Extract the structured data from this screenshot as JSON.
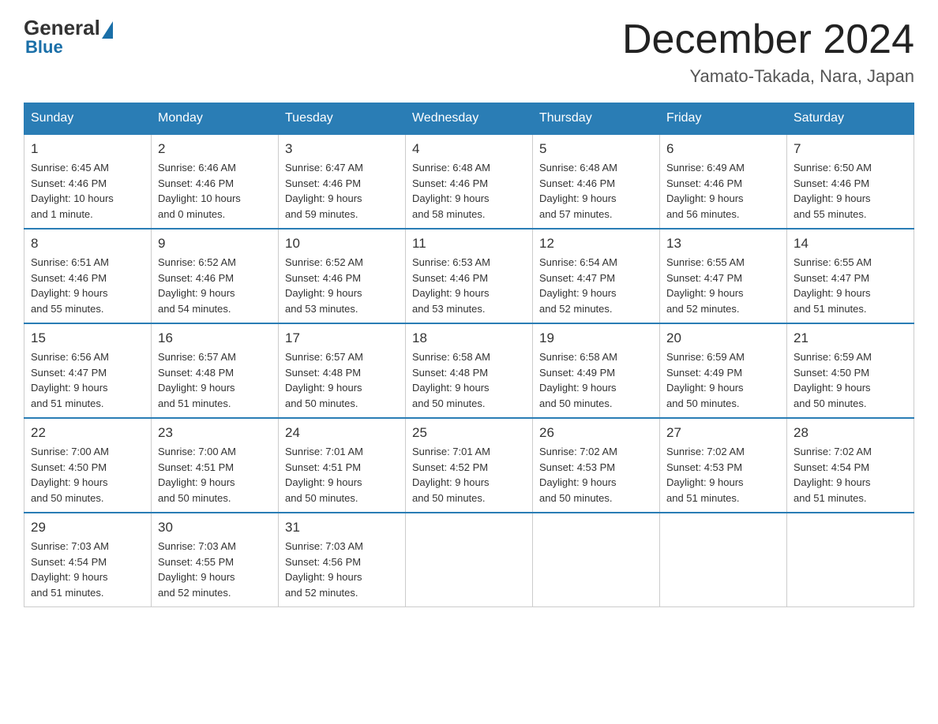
{
  "logo": {
    "general": "General",
    "blue": "Blue"
  },
  "header": {
    "month_title": "December 2024",
    "location": "Yamato-Takada, Nara, Japan"
  },
  "weekdays": [
    "Sunday",
    "Monday",
    "Tuesday",
    "Wednesday",
    "Thursday",
    "Friday",
    "Saturday"
  ],
  "weeks": [
    [
      {
        "day": "1",
        "sunrise": "6:45 AM",
        "sunset": "4:46 PM",
        "daylight": "10 hours and 1 minute."
      },
      {
        "day": "2",
        "sunrise": "6:46 AM",
        "sunset": "4:46 PM",
        "daylight": "10 hours and 0 minutes."
      },
      {
        "day": "3",
        "sunrise": "6:47 AM",
        "sunset": "4:46 PM",
        "daylight": "9 hours and 59 minutes."
      },
      {
        "day": "4",
        "sunrise": "6:48 AM",
        "sunset": "4:46 PM",
        "daylight": "9 hours and 58 minutes."
      },
      {
        "day": "5",
        "sunrise": "6:48 AM",
        "sunset": "4:46 PM",
        "daylight": "9 hours and 57 minutes."
      },
      {
        "day": "6",
        "sunrise": "6:49 AM",
        "sunset": "4:46 PM",
        "daylight": "9 hours and 56 minutes."
      },
      {
        "day": "7",
        "sunrise": "6:50 AM",
        "sunset": "4:46 PM",
        "daylight": "9 hours and 55 minutes."
      }
    ],
    [
      {
        "day": "8",
        "sunrise": "6:51 AM",
        "sunset": "4:46 PM",
        "daylight": "9 hours and 55 minutes."
      },
      {
        "day": "9",
        "sunrise": "6:52 AM",
        "sunset": "4:46 PM",
        "daylight": "9 hours and 54 minutes."
      },
      {
        "day": "10",
        "sunrise": "6:52 AM",
        "sunset": "4:46 PM",
        "daylight": "9 hours and 53 minutes."
      },
      {
        "day": "11",
        "sunrise": "6:53 AM",
        "sunset": "4:46 PM",
        "daylight": "9 hours and 53 minutes."
      },
      {
        "day": "12",
        "sunrise": "6:54 AM",
        "sunset": "4:47 PM",
        "daylight": "9 hours and 52 minutes."
      },
      {
        "day": "13",
        "sunrise": "6:55 AM",
        "sunset": "4:47 PM",
        "daylight": "9 hours and 52 minutes."
      },
      {
        "day": "14",
        "sunrise": "6:55 AM",
        "sunset": "4:47 PM",
        "daylight": "9 hours and 51 minutes."
      }
    ],
    [
      {
        "day": "15",
        "sunrise": "6:56 AM",
        "sunset": "4:47 PM",
        "daylight": "9 hours and 51 minutes."
      },
      {
        "day": "16",
        "sunrise": "6:57 AM",
        "sunset": "4:48 PM",
        "daylight": "9 hours and 51 minutes."
      },
      {
        "day": "17",
        "sunrise": "6:57 AM",
        "sunset": "4:48 PM",
        "daylight": "9 hours and 50 minutes."
      },
      {
        "day": "18",
        "sunrise": "6:58 AM",
        "sunset": "4:48 PM",
        "daylight": "9 hours and 50 minutes."
      },
      {
        "day": "19",
        "sunrise": "6:58 AM",
        "sunset": "4:49 PM",
        "daylight": "9 hours and 50 minutes."
      },
      {
        "day": "20",
        "sunrise": "6:59 AM",
        "sunset": "4:49 PM",
        "daylight": "9 hours and 50 minutes."
      },
      {
        "day": "21",
        "sunrise": "6:59 AM",
        "sunset": "4:50 PM",
        "daylight": "9 hours and 50 minutes."
      }
    ],
    [
      {
        "day": "22",
        "sunrise": "7:00 AM",
        "sunset": "4:50 PM",
        "daylight": "9 hours and 50 minutes."
      },
      {
        "day": "23",
        "sunrise": "7:00 AM",
        "sunset": "4:51 PM",
        "daylight": "9 hours and 50 minutes."
      },
      {
        "day": "24",
        "sunrise": "7:01 AM",
        "sunset": "4:51 PM",
        "daylight": "9 hours and 50 minutes."
      },
      {
        "day": "25",
        "sunrise": "7:01 AM",
        "sunset": "4:52 PM",
        "daylight": "9 hours and 50 minutes."
      },
      {
        "day": "26",
        "sunrise": "7:02 AM",
        "sunset": "4:53 PM",
        "daylight": "9 hours and 50 minutes."
      },
      {
        "day": "27",
        "sunrise": "7:02 AM",
        "sunset": "4:53 PM",
        "daylight": "9 hours and 51 minutes."
      },
      {
        "day": "28",
        "sunrise": "7:02 AM",
        "sunset": "4:54 PM",
        "daylight": "9 hours and 51 minutes."
      }
    ],
    [
      {
        "day": "29",
        "sunrise": "7:03 AM",
        "sunset": "4:54 PM",
        "daylight": "9 hours and 51 minutes."
      },
      {
        "day": "30",
        "sunrise": "7:03 AM",
        "sunset": "4:55 PM",
        "daylight": "9 hours and 52 minutes."
      },
      {
        "day": "31",
        "sunrise": "7:03 AM",
        "sunset": "4:56 PM",
        "daylight": "9 hours and 52 minutes."
      },
      null,
      null,
      null,
      null
    ]
  ],
  "labels": {
    "sunrise": "Sunrise:",
    "sunset": "Sunset:",
    "daylight": "Daylight:"
  }
}
